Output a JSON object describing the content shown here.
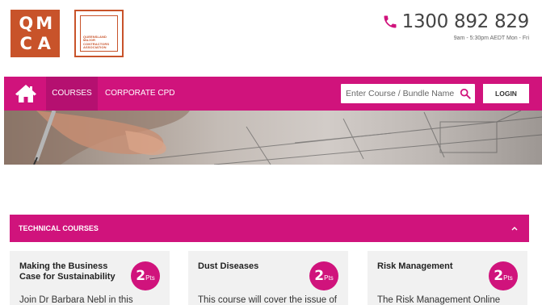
{
  "header": {
    "logo_letters": [
      "Q",
      "M",
      "C",
      "A"
    ],
    "association_lines": [
      "QUEENSLAND",
      "MAJOR",
      "CONTRACTORS",
      "ASSOCIATION"
    ],
    "phone_number": "1300 892 829",
    "phone_hours": "9am - 5:30pm AEDT Mon - Fri"
  },
  "nav": {
    "items": [
      {
        "label": "COURSES",
        "active": true
      },
      {
        "label": "CORPORATE CPD",
        "active": false
      }
    ],
    "search_placeholder": "Enter Course / Bundle Name",
    "login_label": "LOGIN"
  },
  "accordion": {
    "title": "TECHNICAL COURSES"
  },
  "cards": [
    {
      "title": "Making the Business Case for Sustainability",
      "points": "2",
      "points_unit": "Pts",
      "description": "Join Dr Barbara Nebl in this"
    },
    {
      "title": "Dust Diseases",
      "points": "2",
      "points_unit": "Pts",
      "description": "This course will cover the issue of"
    },
    {
      "title": "Risk Management",
      "points": "2",
      "points_unit": "Pts",
      "description": "The Risk Management Online"
    }
  ],
  "colors": {
    "brand_orange": "#c8532a",
    "brand_magenta": "#d0137c",
    "nav_active": "#b51070"
  }
}
